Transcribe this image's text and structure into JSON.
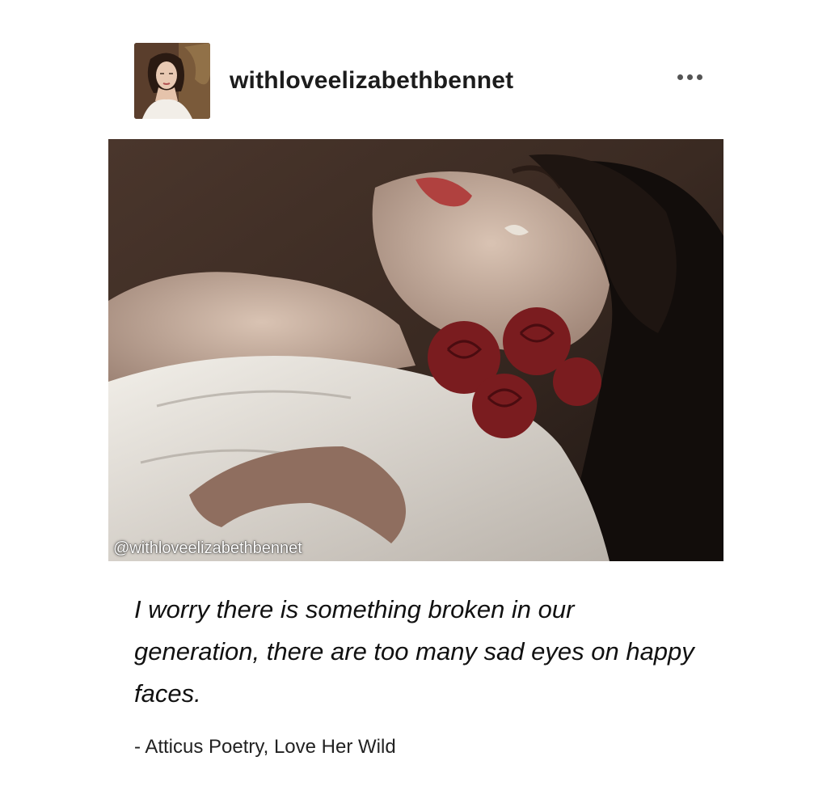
{
  "post": {
    "username": "withloveelizabethbennet",
    "more_icon": "more-horizontal-icon",
    "image_watermark": "@withloveelizabethbennet",
    "quote": "I worry there is something broken in our generation, there are too many sad eyes on happy faces.",
    "attribution": "- Atticus Poetry, Love Her Wild"
  }
}
